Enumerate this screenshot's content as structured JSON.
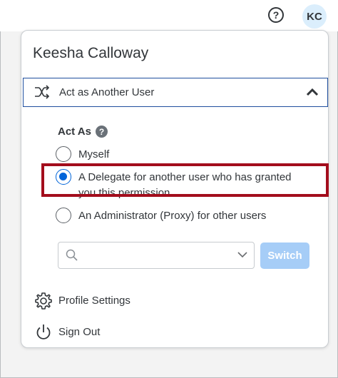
{
  "topbar": {
    "help_glyph": "?",
    "avatar_initials": "KC"
  },
  "panel": {
    "user_name": "Keesha Calloway",
    "section_title": "Act as Another User",
    "act_as_label": "Act As",
    "info_glyph": "?",
    "options": [
      {
        "label": "Myself",
        "selected": false
      },
      {
        "label": "A Delegate for another user who has granted you this permission",
        "selected": true
      },
      {
        "label": "An Administrator (Proxy) for other users",
        "selected": false
      }
    ],
    "search": {
      "value": "",
      "placeholder": ""
    },
    "switch_label": "Switch",
    "menu": {
      "profile_settings": "Profile Settings",
      "sign_out": "Sign Out"
    }
  },
  "colors": {
    "accent": "#0064d9",
    "highlight_border": "#a30d1c",
    "header_border": "#1f4e9e",
    "switch_disabled": "#a6cdf7",
    "avatar_bg": "#dbeefc"
  },
  "icons": [
    "help-icon",
    "shuffle-icon",
    "chevron-up-icon",
    "info-icon",
    "search-icon",
    "chevron-down-icon",
    "gear-icon",
    "power-icon"
  ]
}
